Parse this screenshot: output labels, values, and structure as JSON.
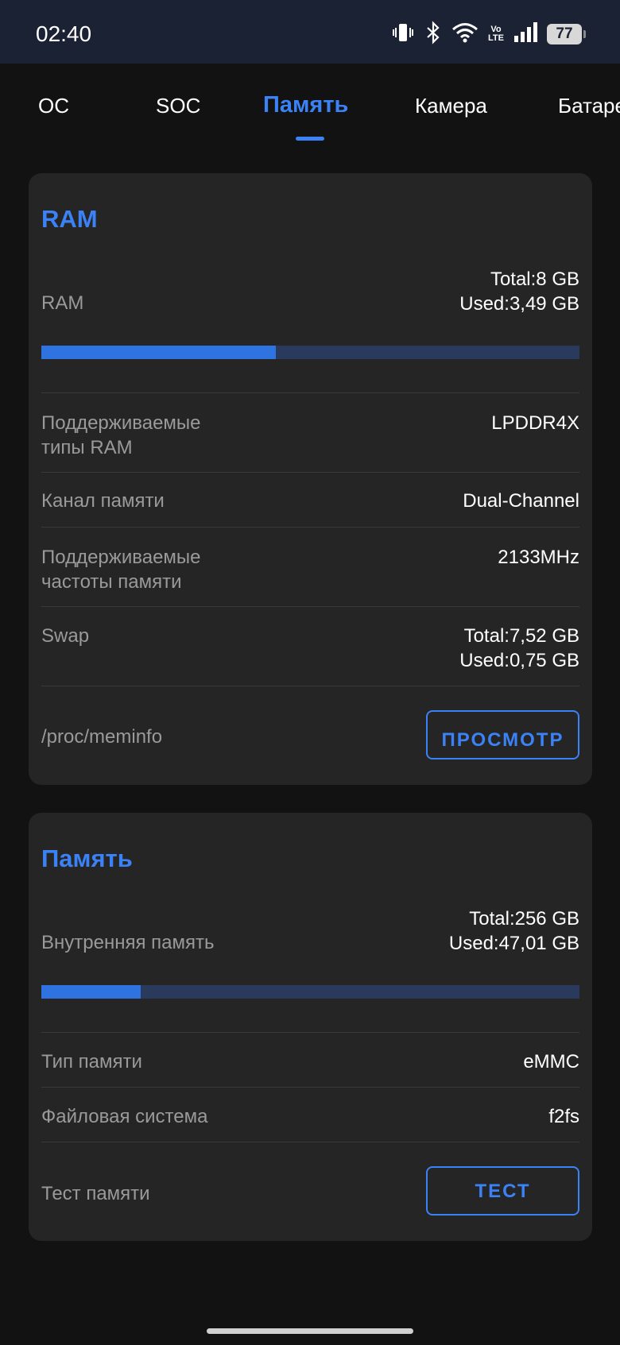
{
  "status_bar": {
    "time": "02:40",
    "battery": "77",
    "volte_top": "Vo",
    "volte_bottom": "LTE",
    "icons": [
      "vibrate-icon",
      "bluetooth-icon",
      "wifi-icon",
      "volte-icon",
      "signal-icon",
      "battery-icon"
    ]
  },
  "tabs": [
    {
      "label": "ОС",
      "active": false
    },
    {
      "label": "SOC",
      "active": false
    },
    {
      "label": "Память",
      "active": true
    },
    {
      "label": "Камера",
      "active": false
    },
    {
      "label": "Батарея",
      "active": false
    }
  ],
  "ram_card": {
    "title": "RAM",
    "ram_label": "RAM",
    "ram_total": "Total:8 GB",
    "ram_used": "Used:3,49 GB",
    "ram_usage_fraction": 0.436,
    "rows": [
      {
        "label": "Поддерживаемые\nтипы RAM",
        "value": "LPDDR4X"
      },
      {
        "label": "Канал памяти",
        "value": "Dual-Channel"
      },
      {
        "label": "Поддерживаемые\nчастоты памяти",
        "value": "2133MHz"
      }
    ],
    "swap_label": "Swap",
    "swap_total": "Total:7,52 GB",
    "swap_used": "Used:0,75 GB",
    "meminfo_label": "/proc/meminfo",
    "view_button": "ПРОСМОТР"
  },
  "storage_card": {
    "title": "Память",
    "internal_label": "Внутренняя память",
    "internal_total": "Total:256 GB",
    "internal_used": "Used:47,01 GB",
    "internal_usage_fraction": 0.184,
    "type_label": "Тип памяти",
    "type_value": "eMMC",
    "fs_label": "Файловая система",
    "fs_value": "f2fs",
    "test_label": "Тест памяти",
    "test_button": "ТЕСТ"
  },
  "colors": {
    "accent": "#3b82f6",
    "card": "#252525",
    "background": "#121212",
    "status_bar": "#1b2233"
  }
}
